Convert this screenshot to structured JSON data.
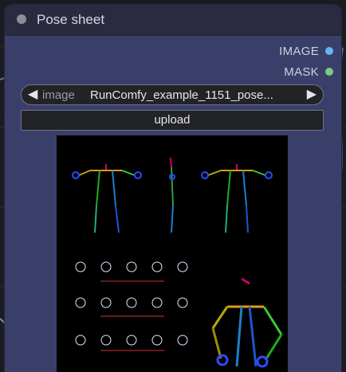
{
  "node": {
    "title": "Pose sheet",
    "outputs": [
      {
        "label": "IMAGE",
        "color": "#64b5f6"
      },
      {
        "label": "MASK",
        "color": "#81c784"
      }
    ],
    "image_widget": {
      "label": "image",
      "value": "RunComfy_example_1151_pose...",
      "prev_arrow": "◀",
      "next_arrow": "▶"
    },
    "upload_button_label": "upload"
  },
  "colors": {
    "canvas": "#1b1b22",
    "node_body": "#3a3f6a",
    "node_header": "#2a2b40",
    "widget_bg": "#222326"
  }
}
